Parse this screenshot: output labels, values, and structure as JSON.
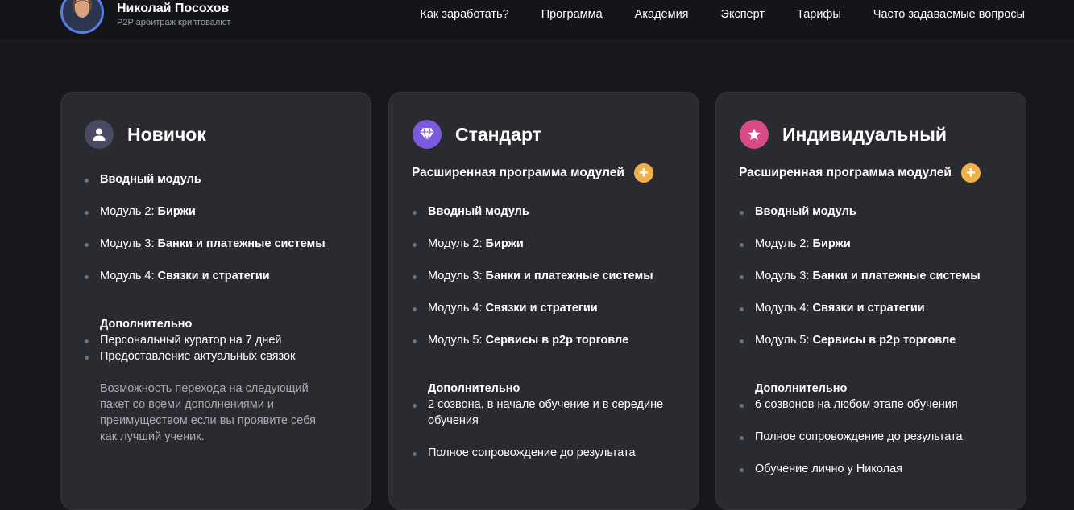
{
  "header": {
    "brand_name": "Николай Посохов",
    "brand_subtitle": "P2P арбитраж криптовалют",
    "nav": [
      "Как заработать?",
      "Программа",
      "Академия",
      "Эксперт",
      "Тарифы",
      "Часто задаваемые вопросы"
    ]
  },
  "plans": [
    {
      "title": "Новичок",
      "icon": "user-icon",
      "icon_color": "#4a4a62",
      "items": [
        {
          "prefix": "",
          "bold": "Вводный модуль"
        },
        {
          "prefix": "Модуль 2: ",
          "bold": "Биржи"
        },
        {
          "prefix": "Модуль 3: ",
          "bold": "Банки и платежные системы"
        },
        {
          "prefix": "Модуль 4: ",
          "bold": "Связки и стратегии"
        }
      ],
      "extra_title": "Дополнительно",
      "extras": [
        "Персональный куратор на 7 дней",
        "Предоставление актуальных связок"
      ],
      "note": "Возможность перехода на следующий пакет со всеми дополнениями и преимуществом если вы проявите себя как лучший ученик."
    },
    {
      "title": "Стандарт",
      "icon": "diamond-icon",
      "icon_color": "#7b5ae0",
      "subheading": "Расширенная программа модулей",
      "items": [
        {
          "prefix": "",
          "bold": "Вводный модуль"
        },
        {
          "prefix": "Модуль 2: ",
          "bold": "Биржи"
        },
        {
          "prefix": "Модуль 3: ",
          "bold": "Банки и платежные системы"
        },
        {
          "prefix": "Модуль 4: ",
          "bold": "Связки и стратегии"
        },
        {
          "prefix": "Модуль 5: ",
          "bold": "Сервисы в p2p торговле"
        }
      ],
      "extra_title": "Дополнительно",
      "extras": [
        "2 созвона, в начале обучение и в середине обучения"
      ],
      "after": [
        "Полное сопровождение до результата"
      ]
    },
    {
      "title": "Индивидуальный",
      "icon": "star-icon",
      "icon_color": "#d94a86",
      "subheading": "Расширенная программа модулей",
      "items": [
        {
          "prefix": "",
          "bold": "Вводный модуль"
        },
        {
          "prefix": "Модуль 2: ",
          "bold": "Биржи"
        },
        {
          "prefix": "Модуль 3: ",
          "bold": "Банки и платежные системы"
        },
        {
          "prefix": "Модуль 4: ",
          "bold": "Связки и стратегии"
        },
        {
          "prefix": "Модуль 5: ",
          "bold": "Сервисы в p2p торговле"
        }
      ],
      "extra_title": "Дополнительно",
      "extras": [
        "6 созвонов на любом этапе обучения"
      ],
      "after": [
        "Полное сопровождение до результата",
        "Обучение лично у Николая"
      ]
    }
  ],
  "plus_icon": "plus-icon",
  "plus_color": "#f0b04a"
}
